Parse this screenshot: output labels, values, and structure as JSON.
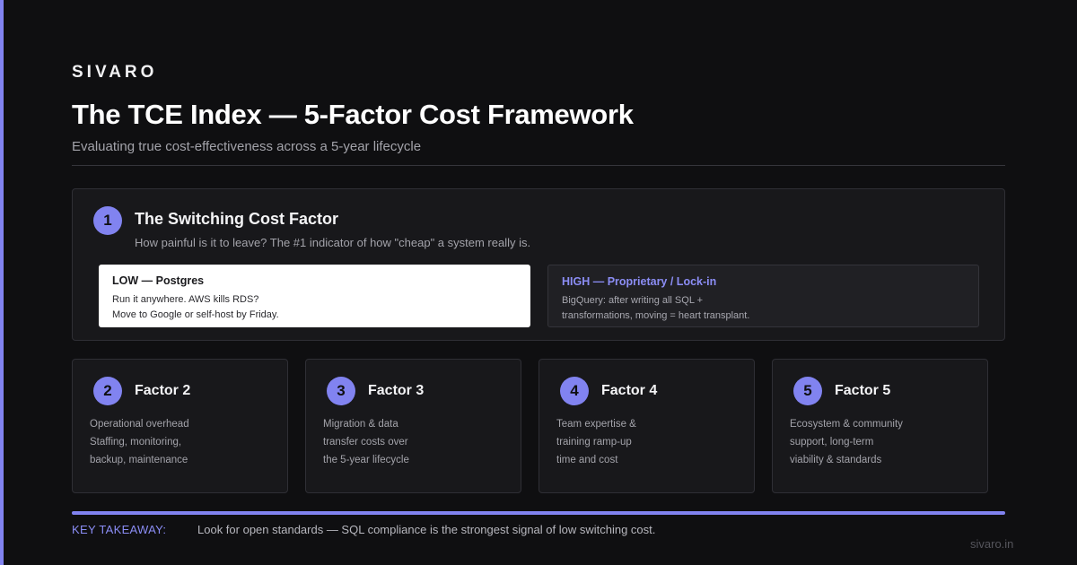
{
  "brand": "SIVARO",
  "title": "The TCE Index — 5-Factor Cost Framework",
  "subtitle": "Evaluating true cost-effectiveness across a 5-year lifecycle",
  "main_factor": {
    "number": "1",
    "title": "The Switching Cost Factor",
    "description": "How painful is it to leave? The #1 indicator of how \"cheap\" a system really is.",
    "low": {
      "heading": "LOW — Postgres",
      "lines": [
        "Run it anywhere. AWS kills RDS?",
        "Move to Google or self-host by Friday."
      ]
    },
    "high": {
      "heading": "HIGH — Proprietary / Lock-in",
      "lines": [
        "BigQuery: after writing all SQL +",
        "transformations, moving = heart transplant."
      ]
    }
  },
  "factors": [
    {
      "number": "2",
      "title": "Factor 2",
      "lines": [
        "Operational overhead",
        "Staffing, monitoring,",
        "backup, maintenance"
      ]
    },
    {
      "number": "3",
      "title": "Factor 3",
      "lines": [
        "Migration & data",
        "transfer costs over",
        "the 5-year lifecycle"
      ]
    },
    {
      "number": "4",
      "title": "Factor 4",
      "lines": [
        "Team expertise &",
        "training ramp-up",
        "time and cost"
      ]
    },
    {
      "number": "5",
      "title": "Factor 5",
      "lines": [
        "Ecosystem & community",
        "support, long-term",
        "viability & standards"
      ]
    }
  ],
  "takeaway": {
    "label": "KEY TAKEAWAY:",
    "text": "Look for open standards — SQL compliance is the strongest signal of low switching cost."
  },
  "footer": "sivaro.in",
  "colors": {
    "accent": "#8183f0",
    "background": "#0f0f11",
    "card": "#18181b"
  }
}
